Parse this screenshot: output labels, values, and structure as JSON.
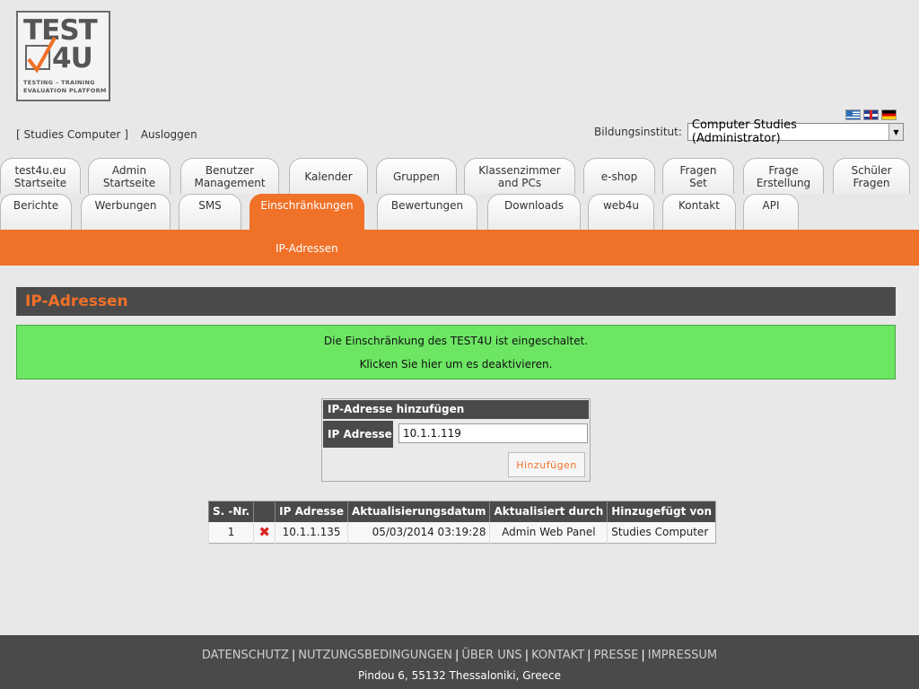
{
  "logo": {
    "line1": "TEST",
    "line2": "4U",
    "tagline1": "TESTING – TRAINING",
    "tagline2": "EVALUATION PLATFORM"
  },
  "user": {
    "name_link": "[ Studies Computer ]",
    "logout": "Ausloggen"
  },
  "languages": [
    "greek-flag",
    "uk-flag",
    "german-flag"
  ],
  "institute": {
    "label": "Bildungsinstitut:",
    "selected": "Computer Studies (Administrator)"
  },
  "tabs_row1": [
    "test4u.eu\nStartseite",
    "Admin\nStartseite",
    "Benutzer\nManagement",
    "Kalender",
    "Gruppen",
    "Klassenzimmer\nand PCs",
    "e-shop",
    "Fragen\nSet",
    "Frage\nErstellung",
    "Schüler\nFragen"
  ],
  "tabs_row2": [
    "Berichte",
    "Werbungen",
    "SMS",
    "Einschränkungen",
    "Bewertungen",
    "Downloads",
    "web4u",
    "Kontakt",
    "API"
  ],
  "subnav": {
    "active": "IP-Adressen"
  },
  "section_title": "IP-Adressen",
  "notice": {
    "line1": "Die Einschränkung des TEST4U ist eingeschaltet.",
    "line2": "Klicken Sie hier um es deaktivieren."
  },
  "add_form": {
    "header": "IP-Adresse hinzufügen",
    "label": "IP Adresse",
    "value": "10.1.1.119",
    "button": "Hinzufügen"
  },
  "table": {
    "headers": [
      "S. -Nr.",
      "",
      "IP Adresse",
      "Aktualisierungsdatum",
      "Aktualisiert durch",
      "Hinzugefügt von"
    ],
    "rows": [
      {
        "nr": "1",
        "ip": "10.1.1.135",
        "date": "05/03/2014 03:19:28",
        "updated_by": "Admin Web Panel",
        "added_by": "Studies Computer"
      }
    ]
  },
  "footer": {
    "links": [
      "DATENSCHUTZ",
      "NUTZUNGSBEDINGUNGEN",
      "ÜBER UNS",
      "KONTAKT",
      "PRESSE",
      "IMPRESSUM"
    ],
    "address": "Pindou 6, 55132 Thessaloniki, Greece"
  },
  "colors": {
    "accent": "#f07128",
    "dark": "#4a4a4a",
    "success": "#6de664"
  }
}
